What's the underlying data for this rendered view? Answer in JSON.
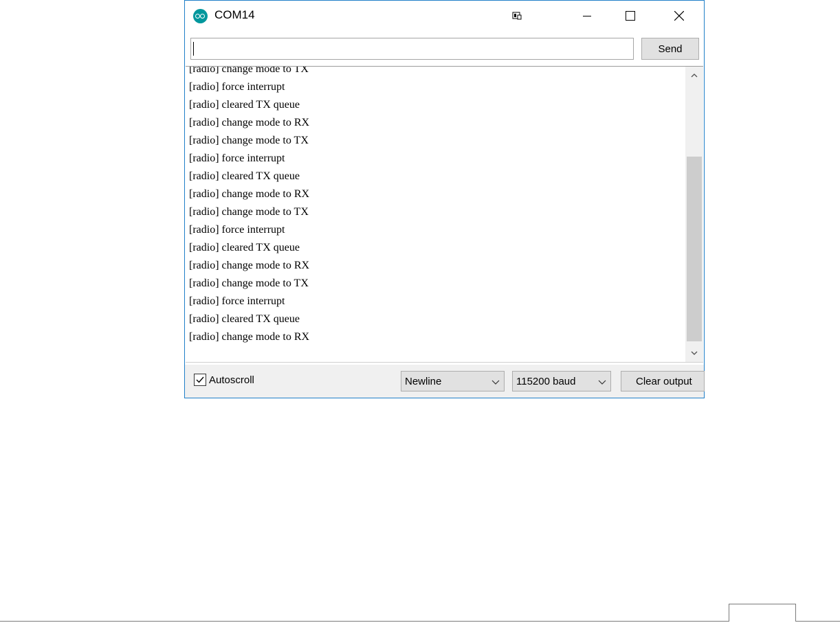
{
  "window": {
    "title": "COM14",
    "accent_color": "#1e7ec8",
    "icon": "arduino-icon"
  },
  "titlebar": {
    "icons": [
      "monitor-icon",
      "minimize-icon",
      "maximize-icon",
      "close-icon"
    ]
  },
  "input": {
    "value": "",
    "send_label": "Send"
  },
  "output": {
    "lines": [
      "[radio] change mode to TX",
      "[radio] force interrupt",
      "[radio] cleared TX queue",
      "[radio] change mode to RX",
      "[radio] change mode to TX",
      "[radio] force interrupt",
      "[radio] cleared TX queue",
      "[radio] change mode to RX",
      "[radio] change mode to TX",
      "[radio] force interrupt",
      "[radio] cleared TX queue",
      "[radio] change mode to RX",
      "[radio] change mode to TX",
      "[radio] force interrupt",
      "[radio] cleared TX queue",
      "[radio] change mode to RX"
    ]
  },
  "statusbar": {
    "autoscroll_label": "Autoscroll",
    "autoscroll_checked": true,
    "line_ending": "Newline",
    "baud_rate": "115200 baud",
    "clear_label": "Clear output"
  }
}
